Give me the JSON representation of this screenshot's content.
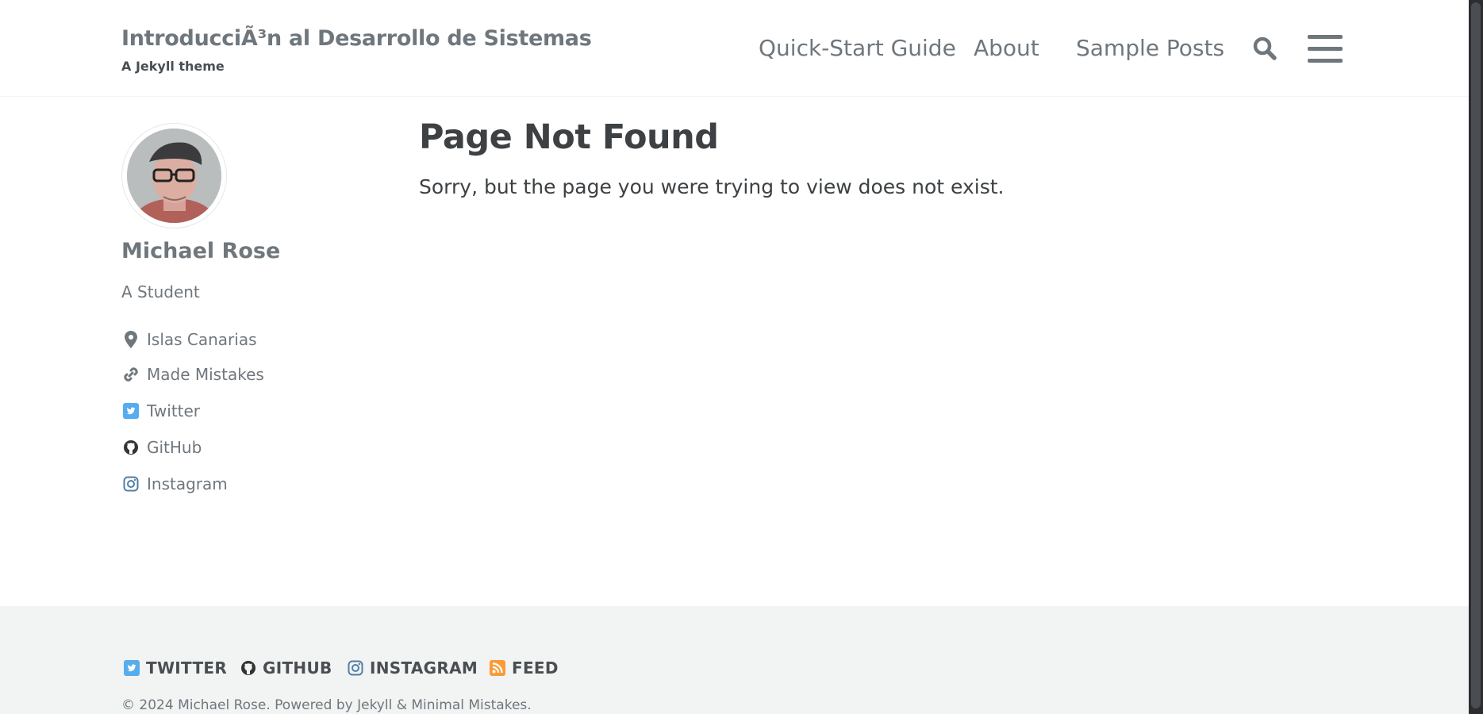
{
  "masthead": {
    "site_title": "IntroducciÃ³n al Desarrollo de Sistemas",
    "site_subtitle": "A Jekyll theme",
    "nav": [
      {
        "label": "Quick-Start Guide"
      },
      {
        "label": "About"
      },
      {
        "label": "Sample Posts"
      }
    ],
    "search_icon": "search-icon",
    "menu_icon": "hamburger-menu-icon"
  },
  "author": {
    "avatar_icon": "author-avatar",
    "name": "Michael Rose",
    "bio": "A Student",
    "links": [
      {
        "label": "Islas Canarias",
        "icon": "map-marker-icon"
      },
      {
        "label": "Made Mistakes",
        "icon": "link-icon"
      },
      {
        "label": "Twitter",
        "icon": "twitter-icon",
        "color": "#55acee"
      },
      {
        "label": "GitHub",
        "icon": "github-icon"
      },
      {
        "label": "Instagram",
        "icon": "instagram-icon"
      }
    ]
  },
  "main": {
    "title": "Page Not Found",
    "text": "Sorry, but the page you were trying to view does not exist."
  },
  "footer": {
    "links": [
      {
        "label": "TWITTER",
        "icon": "twitter-icon",
        "color": "#55acee"
      },
      {
        "label": "GITHUB",
        "icon": "github-icon"
      },
      {
        "label": "INSTAGRAM",
        "icon": "instagram-icon"
      },
      {
        "label": "FEED",
        "icon": "rss-icon",
        "color": "#fa9b39"
      }
    ],
    "copyright": "© 2024 Michael Rose. Powered by Jekyll & Minimal Mistakes."
  },
  "colors": {
    "text": "#494e52",
    "muted": "#6f777d",
    "footer_bg": "#f2f3f3",
    "twitter": "#55acee",
    "rss": "#fa9b39",
    "scrollbar": "#2b2d30"
  }
}
